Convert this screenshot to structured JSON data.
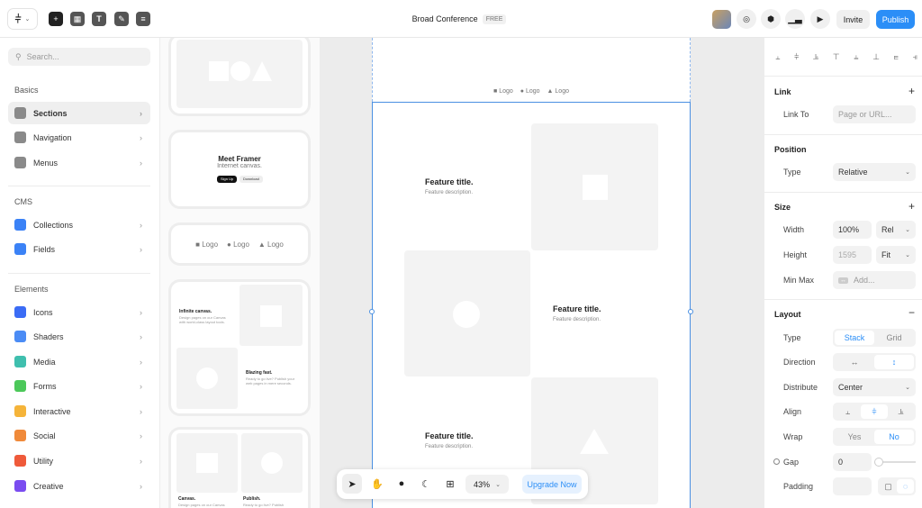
{
  "topbar": {
    "project_title": "Broad Conference",
    "plan_badge": "FREE",
    "invite_label": "Invite",
    "publish_label": "Publish",
    "accent": "#2b8ef7"
  },
  "left": {
    "search_placeholder": "Search...",
    "sections": [
      {
        "title": "Basics",
        "items": [
          {
            "label": "Sections",
            "icon": "sections-icon",
            "color": "#8a8a8a"
          },
          {
            "label": "Navigation",
            "icon": "navigation-icon",
            "color": "#8a8a8a"
          },
          {
            "label": "Menus",
            "icon": "menus-icon",
            "color": "#8a8a8a"
          }
        ]
      },
      {
        "title": "CMS",
        "items": [
          {
            "label": "Collections",
            "icon": "collections-icon",
            "color": "#3b82f6"
          },
          {
            "label": "Fields",
            "icon": "fields-icon",
            "color": "#3b82f6"
          }
        ]
      },
      {
        "title": "Elements",
        "items": [
          {
            "label": "Icons",
            "icon": "star-icon",
            "color": "#3b6cf5"
          },
          {
            "label": "Shaders",
            "icon": "sparkle-icon",
            "color": "#4b8cf5"
          },
          {
            "label": "Media",
            "icon": "play-icon",
            "color": "#3fbfae"
          },
          {
            "label": "Forms",
            "icon": "form-icon",
            "color": "#4cc85a"
          },
          {
            "label": "Interactive",
            "icon": "lightning-icon",
            "color": "#f5b43a"
          },
          {
            "label": "Social",
            "icon": "person-icon",
            "color": "#f08a3a"
          },
          {
            "label": "Utility",
            "icon": "utility-icon",
            "color": "#ef5a3a"
          },
          {
            "label": "Creative",
            "icon": "creative-icon",
            "color": "#7a4cf0"
          }
        ]
      }
    ]
  },
  "thumbs": {
    "hero_title": "Meet Framer",
    "hero_sub": "Internet canvas.",
    "hero_btn1": "Sign Up",
    "hero_btn2": "Download",
    "logo_label": "Logo",
    "f1_title": "Infinite canvas.",
    "f1_desc": "Design pages on our Canvas with world-class layout tools.",
    "f2_title": "Blazing fast.",
    "f2_desc": "Ready to go live? Publish your web pages in mere seconds.",
    "g1_title": "Canvas.",
    "g1_desc": "Design pages on our Canvas",
    "g2_title": "Publish.",
    "g2_desc": "Ready to go live? Publish"
  },
  "canvas": {
    "logo_label": "Logo",
    "feature_title": "Feature title.",
    "feature_desc": "Feature description."
  },
  "toolbar": {
    "zoom": "43%",
    "upgrade_label": "Upgrade Now"
  },
  "right": {
    "link_h": "Link",
    "link_to": "Link To",
    "link_placeholder": "Page or URL...",
    "position_h": "Position",
    "type_label": "Type",
    "position_value": "Relative",
    "size_h": "Size",
    "width_label": "Width",
    "width_value": "100%",
    "width_unit": "Rel",
    "height_label": "Height",
    "height_value": "1595",
    "height_unit": "Fit",
    "minmax_label": "Min Max",
    "minmax_value": "Add...",
    "layout_h": "Layout",
    "layout_type_label": "Type",
    "stack": "Stack",
    "grid": "Grid",
    "direction_label": "Direction",
    "distribute_label": "Distribute",
    "distribute_value": "Center",
    "align_label": "Align",
    "wrap_label": "Wrap",
    "wrap_yes": "Yes",
    "wrap_no": "No",
    "gap_label": "Gap",
    "gap_value": "0",
    "padding_label": "Padding"
  }
}
